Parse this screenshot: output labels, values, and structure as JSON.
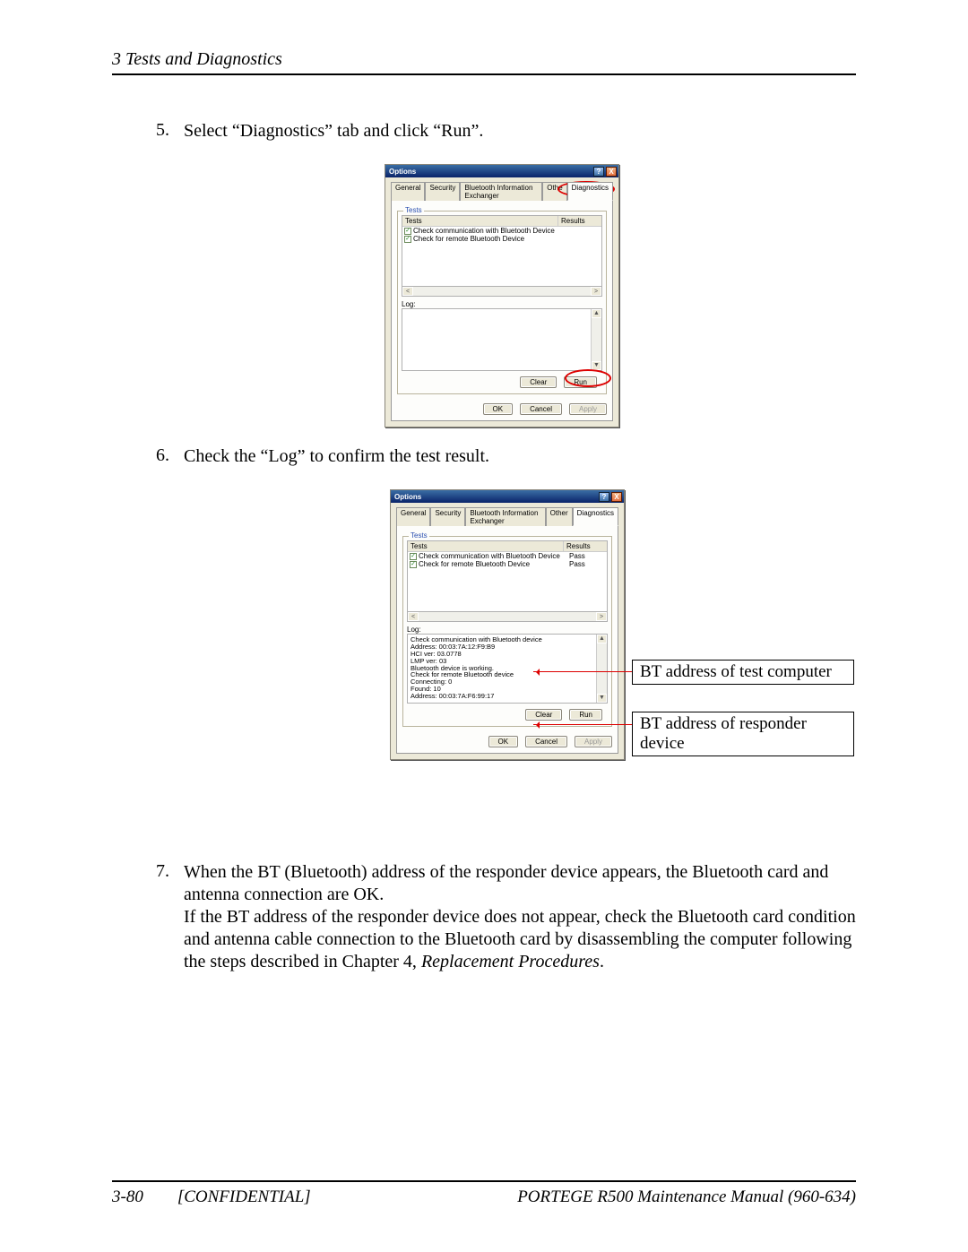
{
  "header": {
    "section": "3  Tests and Diagnostics"
  },
  "steps": {
    "s5": {
      "num": "5.",
      "text": "Select “Diagnostics” tab and click “Run”."
    },
    "s6": {
      "num": "6.",
      "text": "Check the “Log” to confirm the test result."
    },
    "s7": {
      "num": "7.",
      "p1": "When the BT (Bluetooth) address of the responder device appears, the Bluetooth card and antenna connection are OK.",
      "p2a": "If the BT address of the responder device does not appear, check the Bluetooth card condition and antenna cable connection to the Bluetooth card by disassembling the computer following the steps described in Chapter 4, ",
      "p2b_italic": "Replacement Procedures",
      "p2c": "."
    }
  },
  "dialog": {
    "title": "Options",
    "help": "?",
    "close": "X",
    "tabs": {
      "general": "General",
      "security": "Security",
      "bie": "Bluetooth Information Exchanger",
      "other": "Other",
      "otherShort": "Othe",
      "diagnostics": "Diagnostics"
    },
    "tests_label": "Tests",
    "grid": {
      "tests_h": "Tests",
      "results_h": "Results",
      "r1": "Check communication with Bluetooth Device",
      "r2": "Check for remote Bluetooth Device",
      "pass": "Pass"
    },
    "log_label": "Log:",
    "scroll": {
      "left": "<",
      "right": ">",
      "up": "▲",
      "down": "▼"
    },
    "buttons": {
      "clear": "Clear",
      "run": "Run",
      "ok": "OK",
      "cancel": "Cancel",
      "apply": "Apply"
    },
    "log2": [
      "Check communication with Bluetooth device",
      "Address: 00:03:7A:12:F9:B9",
      "HCI ver: 03.0778",
      "LMP ver: 03",
      "Bluetooth device is working.",
      "Check for remote Bluetooth device",
      "Connecting: 0",
      "Found: 10",
      "Address: 00:03:7A:F6:99:17"
    ]
  },
  "callouts": {
    "c1": "BT address of test computer",
    "c2": "BT address of responder device"
  },
  "footer": {
    "page": "3-80",
    "conf": "[CONFIDENTIAL]",
    "manual": "PORTEGE R500 Maintenance Manual (960-634)"
  }
}
